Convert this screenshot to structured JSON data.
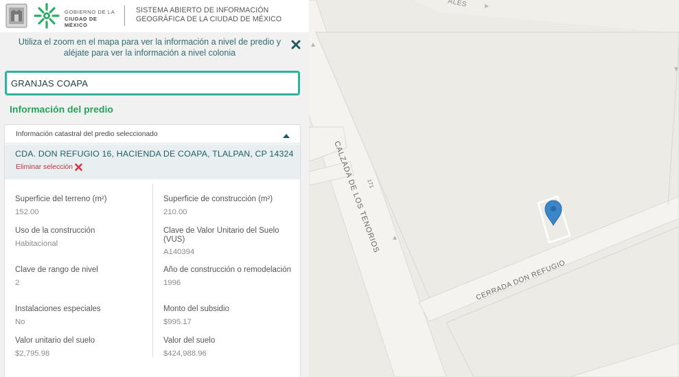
{
  "header": {
    "gov_line1": "GOBIERNO DE LA",
    "gov_line2": "CIUDAD DE MÉXICO",
    "system_line1": "SISTEMA ABIERTO DE INFORMACIÓN",
    "system_line2": "GEOGRÁFICA DE LA CIUDAD DE MÉXICO"
  },
  "panel": {
    "zoom_hint": "Utiliza el zoom en el mapa para ver la información a nivel de predio y aléjate para ver la información a nivel colonia",
    "search_value": "GRANJAS COAPA",
    "section_title": "Información del predio",
    "card_header": "Información catastral del predio seleccionado",
    "address": "CDA. DON REFUGIO 16, HACIENDA DE COAPA, TLALPAN, CP 14324",
    "remove_selection": "Eliminar selección",
    "fields_left": [
      {
        "label": "Superficie del terreno (m²)",
        "value": "152.00"
      },
      {
        "label": "Uso de la construcción",
        "value": "Habitacional"
      },
      {
        "label": "Clave de rango de nivel",
        "value": "2"
      },
      {
        "label": "Instalaciones especiales",
        "value": "No"
      },
      {
        "label": "Valor unitario del suelo",
        "value": "$2,795.98"
      }
    ],
    "fields_right": [
      {
        "label": "Superficie de construcción (m²)",
        "value": "210.00"
      },
      {
        "label": "Clave de Valor Unitario del Suelo (VUS)",
        "value": "A140394"
      },
      {
        "label": "Año de construcción o remodelación",
        "value": "1996"
      },
      {
        "label": "Monto del subsidio",
        "value": "$995.17"
      },
      {
        "label": "Valor del suelo",
        "value": "$424,988.96"
      }
    ]
  },
  "map": {
    "street_calzada": "CALZADA DE LOS TENORIOS",
    "street_cerrada": "CERRADA DON REFUGIO",
    "street_top": "ALES",
    "number_label": "171",
    "marker_color": "#3a86c8",
    "accent_teal": "#2bb3a0",
    "accent_green": "#25a35a"
  }
}
